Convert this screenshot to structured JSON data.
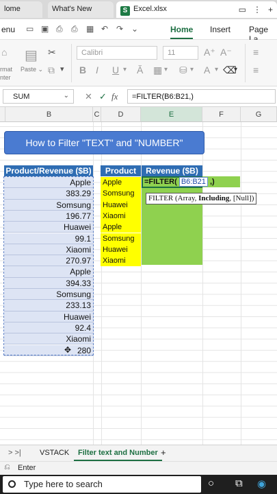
{
  "browser_tabs": [
    {
      "label": "lome"
    },
    {
      "label": "What's New"
    },
    {
      "label": "Excel.xlsx"
    }
  ],
  "app_badge": "S",
  "ribbon_tabs": [
    "enu",
    "Home",
    "Insert",
    "Page La"
  ],
  "ribbon_labels": {
    "format_painter": "rmat",
    "painter_2": "nter",
    "paste": "Paste",
    "font_name": "Calibri",
    "font_size": "11"
  },
  "formula_bar": {
    "name_box": "SUM",
    "fx_label": "fx",
    "formula": "=FILTER(B6:B21,)"
  },
  "columns": [
    {
      "label": "B"
    },
    {
      "label": "C"
    },
    {
      "label": "D"
    },
    {
      "label": "E"
    },
    {
      "label": "F"
    },
    {
      "label": "G"
    }
  ],
  "title_banner": "How to Filter \"TEXT\" and \"NUMBER\"",
  "table_b": {
    "header": "Product/Revenue ($B)",
    "values": [
      "Apple",
      "383.29",
      "Somsung",
      "196.77",
      "Huawei",
      "99.1",
      "Xiaomi",
      "270.97",
      "Apple",
      "394.33",
      "Somsung",
      "233.13",
      "Huawei",
      "92.4",
      "Xiaomi",
      "280"
    ]
  },
  "table_d": {
    "header": "Product",
    "values": [
      "Apple",
      "Somsung",
      "Huawei",
      "Xiaomi",
      "Apple",
      "Somsung",
      "Huawei",
      "Xiaomi"
    ]
  },
  "table_e": {
    "header": "Revenue ($B)",
    "active_prefix": "=FILTER( ",
    "active_ref": "B6:B21",
    "active_suffix": " ,)"
  },
  "tooltip": {
    "prefix": "FILTER (Array, ",
    "bold": "Including",
    "suffix": ", [Null])"
  },
  "sheet_tabs": {
    "nav": ">   >|",
    "tabs": [
      "VSTACK",
      "Filter text and Number"
    ],
    "add": "+"
  },
  "status": "Enter",
  "taskbar": {
    "search_placeholder": "Type here to search"
  },
  "colors": {
    "accent": "#1d6f42",
    "header_blue": "#2f6db3",
    "yellow": "#ffff00",
    "green": "#8fd14f"
  }
}
